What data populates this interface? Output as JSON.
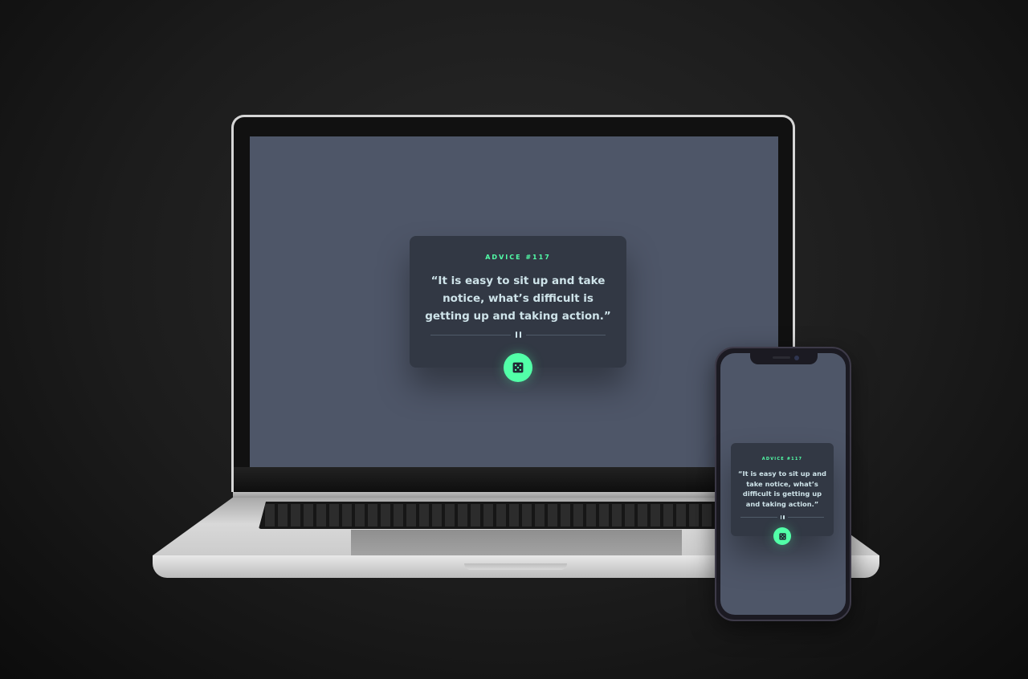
{
  "desktop_card": {
    "advice_label": "ADVICE #117",
    "quote": "“It is easy to sit up and take notice, what’s difficult is getting up and taking action.”"
  },
  "mobile_card": {
    "advice_label": "ADVICE #117",
    "quote": "“It is easy to sit up and take notice, what’s difficult is getting up and taking action.”"
  },
  "colors": {
    "accent": "#52ffa8",
    "card_bg": "#323844",
    "screen_bg": "#4e5668",
    "quote_text": "#cee3e9"
  },
  "icons": {
    "dice": "dice-icon",
    "divider": "pause-icon"
  }
}
